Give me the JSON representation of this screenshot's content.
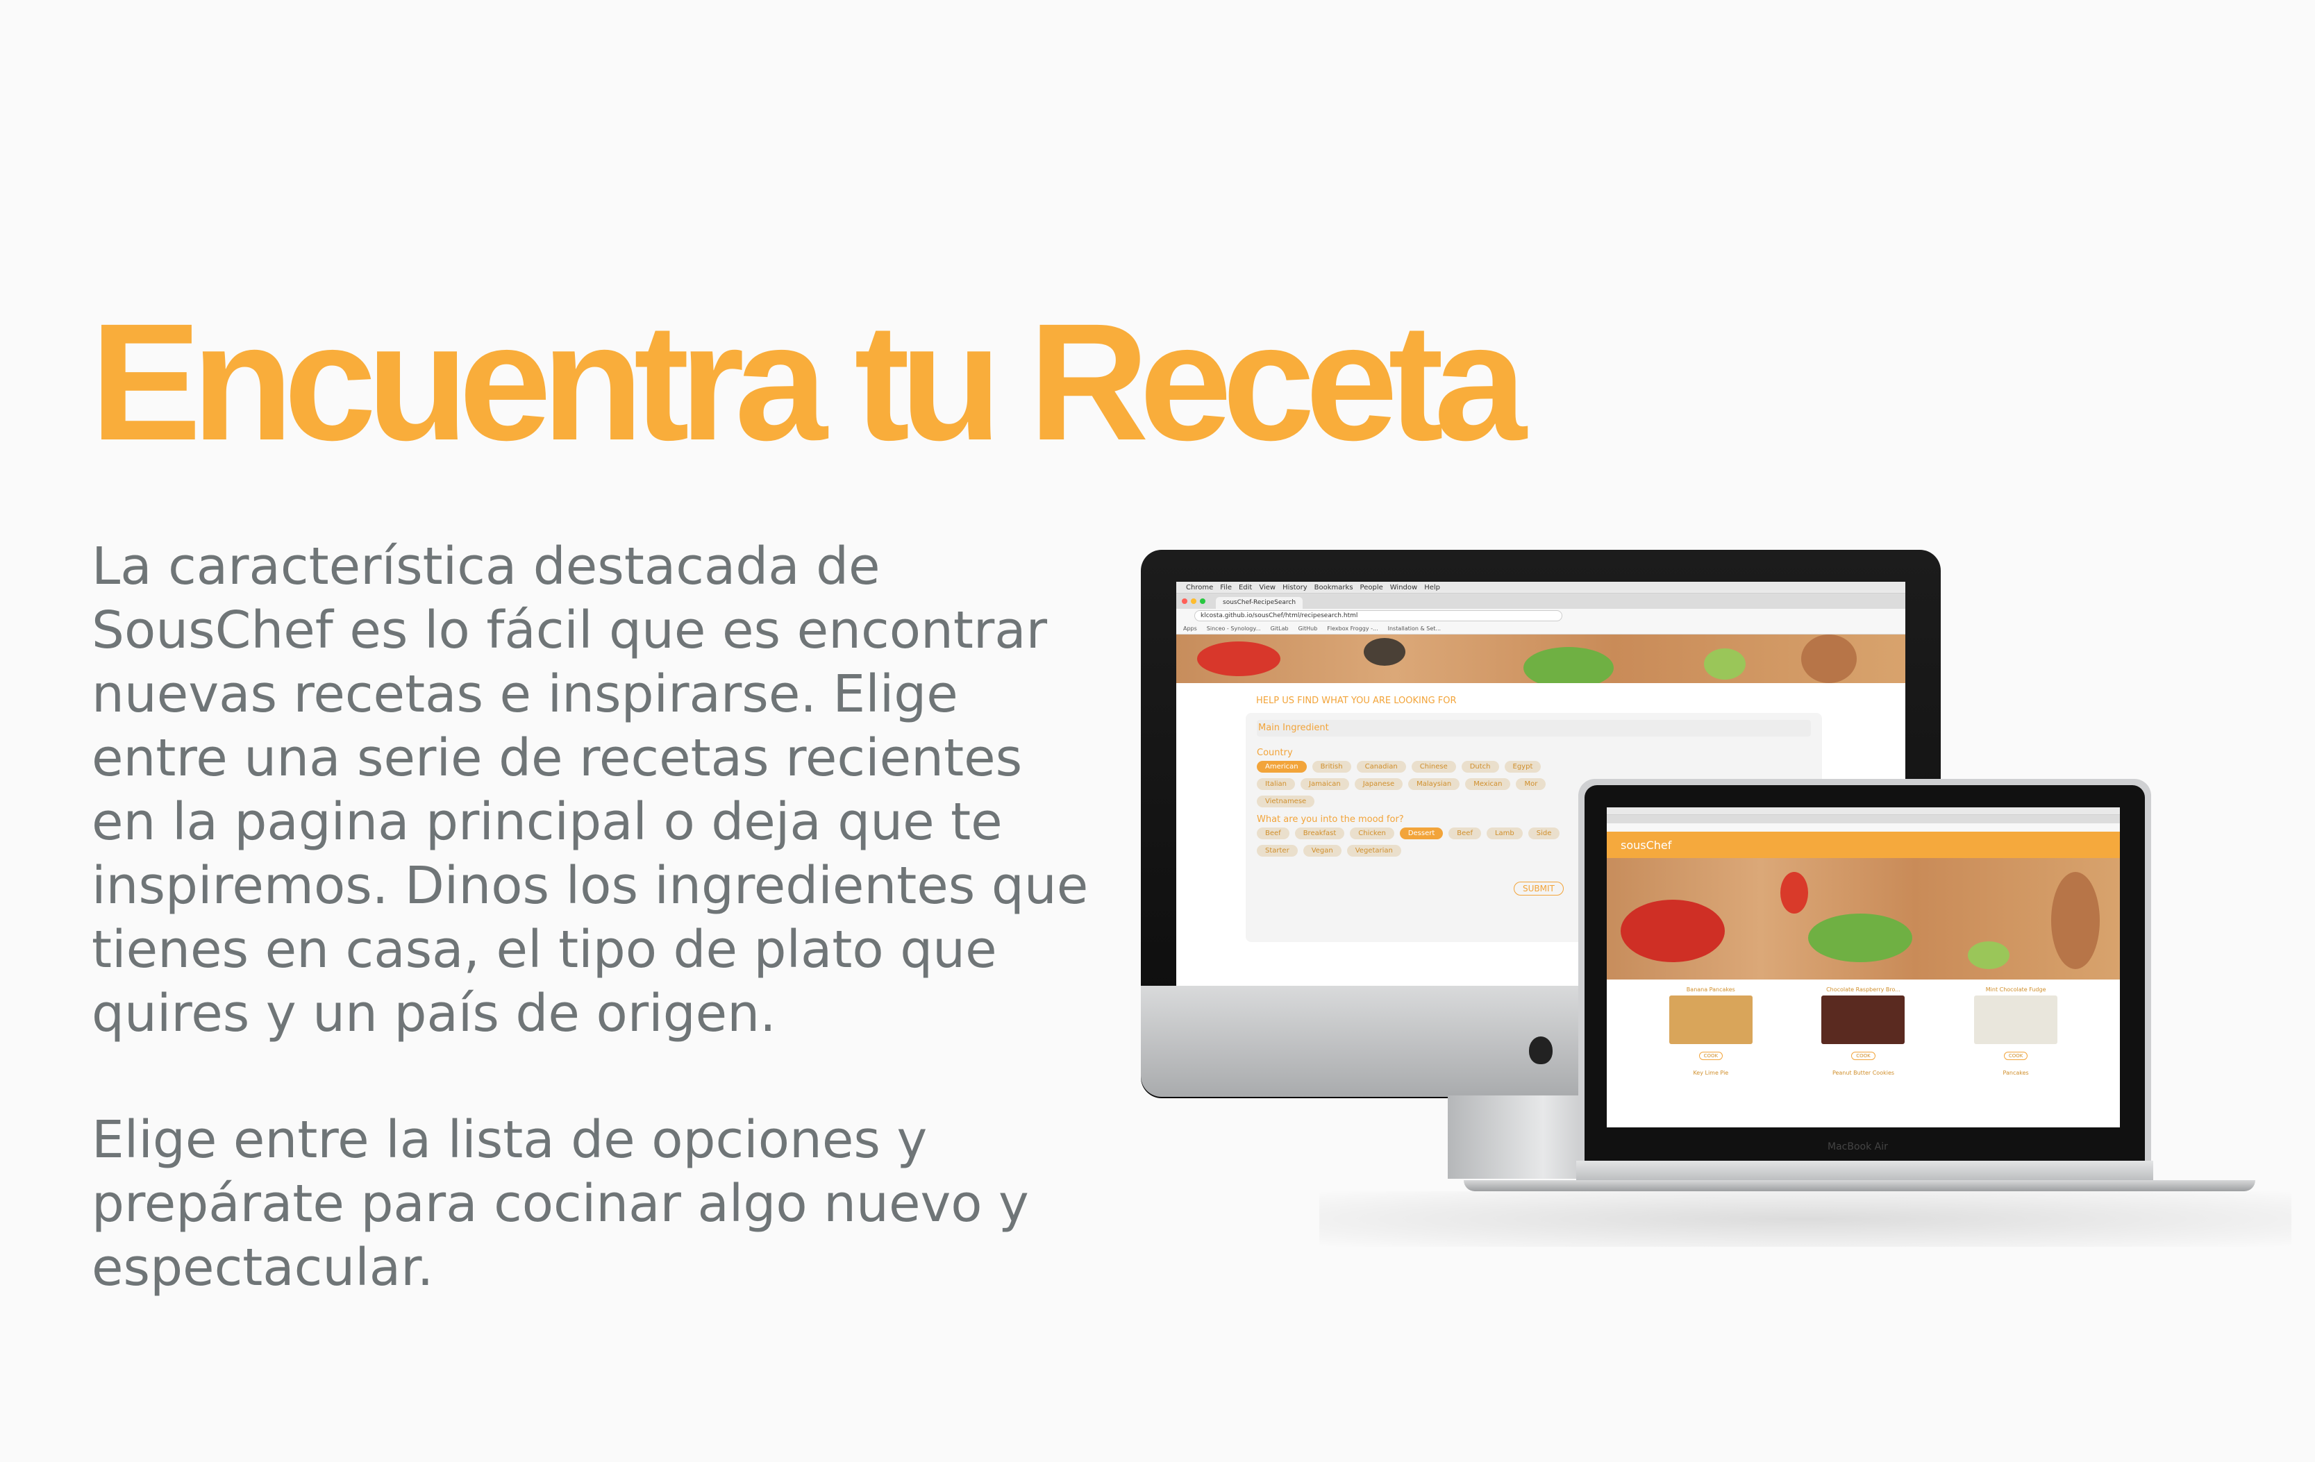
{
  "headline": "Encuentra tu Receta",
  "paragraph1": "La característica destacada de SousChef es lo fácil que es encontrar nuevas recetas e inspirarse. Elige entre una serie de recetas recientes en la pagina principal o deja que te inspiremos. Dinos los ingredientes que tienes en casa, el tipo de plato que quires y un país de origen.",
  "paragraph2": "Elige entre la lista de opciones y prepárate para cocinar algo nuevo y espectacular.",
  "colors": {
    "accent": "#f9ad3b",
    "body_text": "#6f7577"
  },
  "imac": {
    "menubar": [
      "Chrome",
      "File",
      "Edit",
      "View",
      "History",
      "Bookmarks",
      "People",
      "Window",
      "Help"
    ],
    "tab_title": "sousChef-RecipeSearch",
    "url": "klcosta.github.io/sousChef/html/recipesearch.html",
    "bookmarks": [
      "Apps",
      "Sinceo - Synology...",
      "GitLab",
      "GitHub",
      "Flexbox Froggy -...",
      "Installation & Set..."
    ],
    "form_title": "HELP US FIND WHAT YOU ARE LOOKING FOR",
    "main_ingredient_label": "Main Ingredient",
    "country_label": "Country",
    "countries": [
      "American",
      "British",
      "Canadian",
      "Chinese",
      "Dutch",
      "Egypt",
      "Italian",
      "Jamaican",
      "Japanese",
      "Malaysian",
      "Mexican",
      "Mor",
      "Vietnamese"
    ],
    "mood_label": "What are you into the mood for?",
    "moods": [
      "Beef",
      "Breakfast",
      "Chicken",
      "Dessert",
      "Beef",
      "Lamb",
      "Side",
      "Starter",
      "Vegan",
      "Vegetarian"
    ],
    "submit_label": "SUBMIT",
    "brand_icon": "apple-logo-icon"
  },
  "macbook": {
    "brand": "sousChef",
    "label": "MacBook Air",
    "cards": [
      {
        "title": "Banana Pancakes",
        "button": "COOK"
      },
      {
        "title": "Chocolate Raspberry Bro...",
        "button": "COOK"
      },
      {
        "title": "Mint Chocolate Fudge",
        "button": "COOK"
      }
    ],
    "next_row": [
      "Key Lime Pie",
      "Peanut Butter Cookies",
      "Pancakes"
    ]
  }
}
